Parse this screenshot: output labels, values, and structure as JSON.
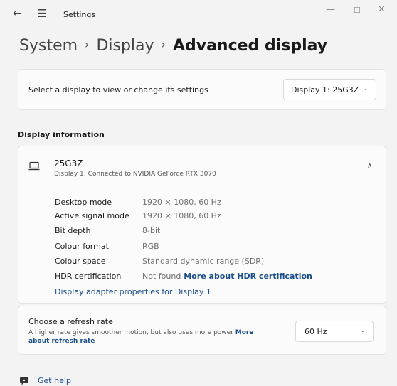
{
  "window": {
    "title": "Settings",
    "back_glyph": "←",
    "menu_glyph": "☰",
    "min_glyph": "—",
    "max_glyph": "☐",
    "close_glyph": "✕"
  },
  "breadcrumb": {
    "items": [
      "System",
      "Display",
      "Advanced display"
    ],
    "separator": "›"
  },
  "select_display": {
    "label": "Select a display to view or change its settings",
    "selected": "Display 1: 25G3Z",
    "chevron_glyph": "⌄"
  },
  "display_information": {
    "heading": "Display information",
    "monitor_name": "25G3Z",
    "subtitle": "Display 1: Connected to NVIDIA GeForce RTX 3070",
    "collapse_glyph": "∧",
    "rows": [
      {
        "label": "Desktop mode",
        "value": "1920 × 1080, 60 Hz"
      },
      {
        "label": "Active signal mode",
        "value": "1920 × 1080, 60 Hz"
      },
      {
        "label": "Bit depth",
        "value": "8-bit"
      },
      {
        "label": "Colour format",
        "value": "RGB"
      },
      {
        "label": "Colour space",
        "value": "Standard dynamic range (SDR)"
      },
      {
        "label": "HDR certification",
        "value": "Not found",
        "link": "More about HDR certification"
      }
    ],
    "adapter_link": "Display adapter properties for Display 1"
  },
  "refresh_rate": {
    "title": "Choose a refresh rate",
    "description": "A higher rate gives smoother motion, but also uses more power",
    "link": "More about refresh rate",
    "selected": "60 Hz",
    "chevron_glyph": "⌄"
  },
  "help": {
    "label": "Get help"
  },
  "colors": {
    "accent_link": "#1a4e8a",
    "background": "#f3f3f3",
    "card": "#fbfbfb"
  }
}
